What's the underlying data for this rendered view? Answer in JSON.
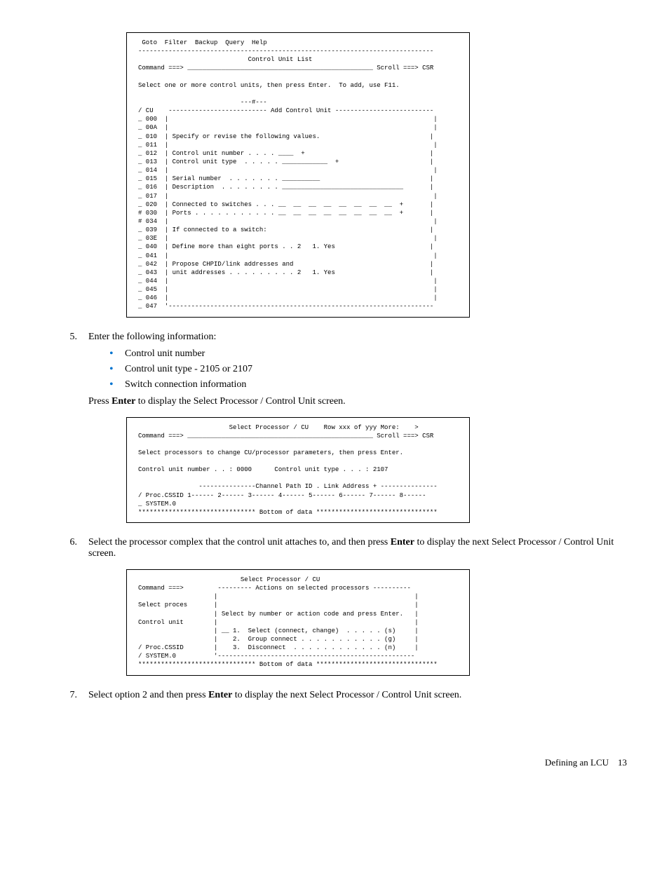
{
  "screen1": " Goto  Filter  Backup  Query  Help\n------------------------------------------------------------------------------\n                             Control Unit List\nCommand ===> _________________________________________________ Scroll ===> CSR\n\nSelect one or more control units, then press Enter.  To add, use F11.\n\n                           ---#---\n/ CU    -------------------------- Add Control Unit --------------------------\n_ 000  |                                                                      |\n_ 00A  |                                                                      |\n_ 010  | Specify or revise the following values.                             |\n_ 011  |                                                                      |\n_ 012  | Control unit number . . . . ____  +                                 |\n_ 013  | Control unit type  . . . . . ____________  +                        |\n_ 014  |                                                                      |\n_ 015  | Serial number  . . . . . . . __________                             |\n_ 016  | Description  . . . . . . . . ________________________________       |\n_ 017  |                                                                      |\n_ 020  | Connected to switches . . . __  __  __  __  __  __  __  __  +       |\n# 030  | Ports . . . . . . . . . . . __  __  __  __  __  __  __  __  +       |\n# 034  |                                                                      |\n_ 039  | If connected to a switch:                                           |\n_ 03E  |                                                                      |\n_ 040  | Define more than eight ports . . 2   1. Yes                         |\n_ 041  |                                                                      |\n_ 042  | Propose CHPID/link addresses and                                    |\n_ 043  | unit addresses . . . . . . . . . 2   1. Yes                         |\n_ 044  |                                                                      |\n_ 045  |                                                                      |\n_ 046  |                                                                      |\n_ 047  '----------------------------------------------------------------------",
  "step5": {
    "num": "5.",
    "intro": "Enter the following information:",
    "b1": "Control unit number",
    "b2": "Control unit type - 2105 or 2107",
    "b3": "Switch connection information",
    "press_a": "Press ",
    "press_enter": "Enter",
    "press_b": " to display the Select Processor / Control Unit screen."
  },
  "screen2": "                        Select Processor / CU    Row xxx of yyy More:    >\nCommand ===> _________________________________________________ Scroll ===> CSR\n\nSelect processors to change CU/processor parameters, then press Enter.\n\nControl unit number . . : 0000      Control unit type . . . : 2107\n\n                ---------------Channel Path ID . Link Address + ---------------\n/ Proc.CSSID 1------ 2------ 3------ 4------ 5------ 6------ 7------ 8------\n_ SYSTEM.0\n******************************* Bottom of data ********************************",
  "step6": {
    "num": "6.",
    "a": "Select the processor complex that the control unit attaches to, and then press ",
    "enter": "Enter",
    "b": " to display the next Select Processor / Control Unit screen."
  },
  "screen3": "                           Select Processor / CU\nCommand ===>         --------- Actions on selected processors ----------\n                    |                                                    |\nSelect proces       |                                                    |\n                    | Select by number or action code and press Enter.   |\nControl unit        |                                                    |\n                    | __ 1.  Select (connect, change)  . . . . . (s)     |\n                    |    2.  Group connect . . . . . . . . . . . (g)     |\n/ Proc.CSSID        |    3.  Disconnect  . . . . . . . . . . . . (n)     |\n/ SYSTEM.0          '----------------------------------------------------\n******************************* Bottom of data ********************************",
  "step7": {
    "num": "7.",
    "a": "Select option 2 and then press ",
    "enter": "Enter",
    "b": " to display the next Select Processor / Control Unit screen."
  },
  "footer": {
    "label": "Defining an LCU",
    "page": "13"
  }
}
